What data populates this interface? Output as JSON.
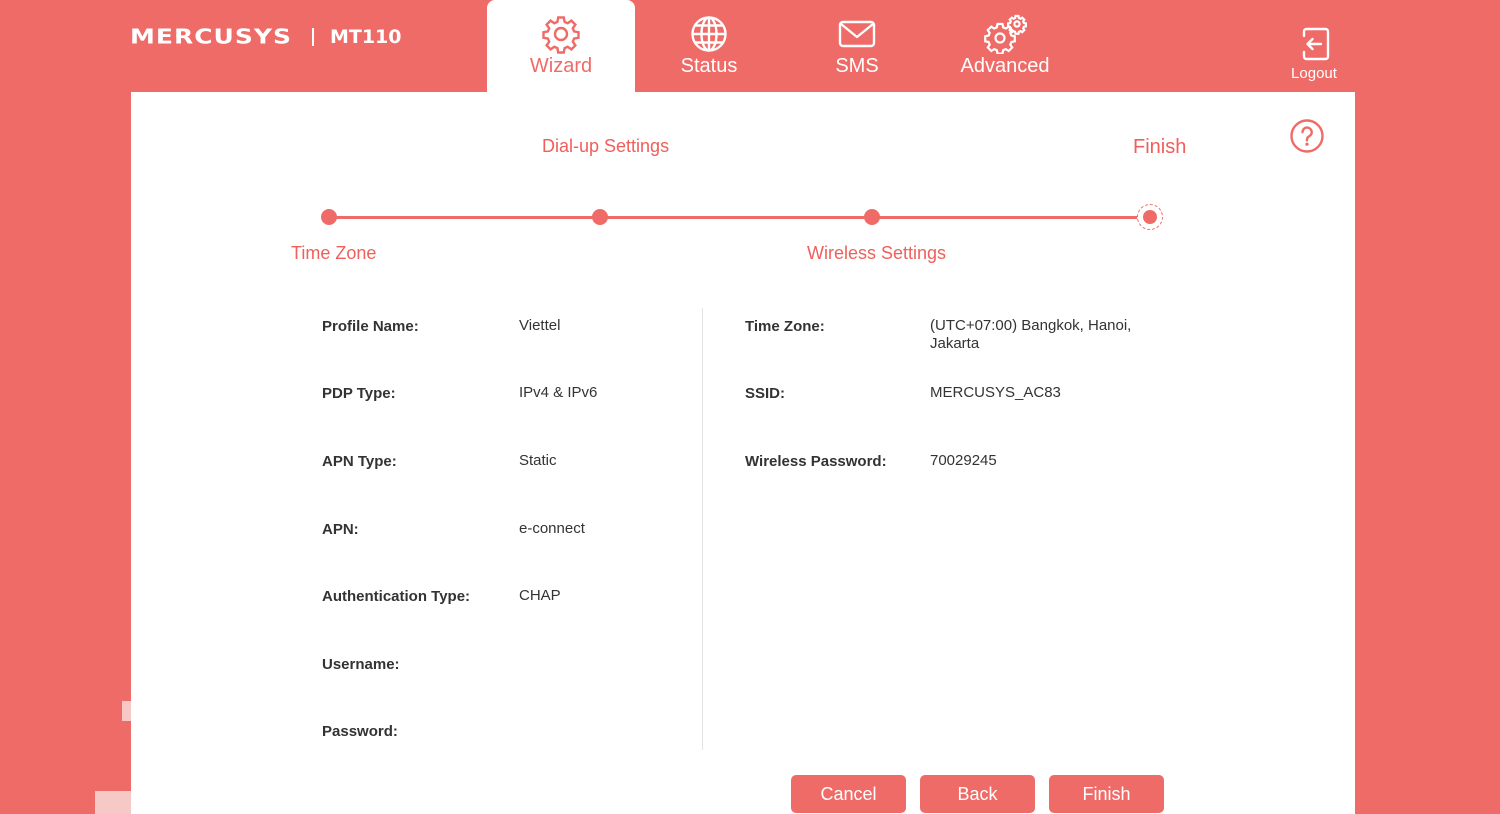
{
  "header": {
    "brand": "MERCUSYS",
    "model": "MT110",
    "tabs": [
      {
        "label": "Wizard",
        "icon": "gear-icon",
        "active": true
      },
      {
        "label": "Status",
        "icon": "globe-icon",
        "active": false
      },
      {
        "label": "SMS",
        "icon": "envelope-icon",
        "active": false
      },
      {
        "label": "Advanced",
        "icon": "gears-icon",
        "active": false
      }
    ],
    "logout_label": "Logout"
  },
  "steps": {
    "labels": [
      "Time Zone",
      "Dial-up Settings",
      "Wireless Settings",
      "Finish"
    ],
    "current": "Finish"
  },
  "summary": {
    "left": [
      {
        "label": "Profile Name:",
        "value": "Viettel"
      },
      {
        "label": "PDP Type:",
        "value": "IPv4 & IPv6"
      },
      {
        "label": "APN Type:",
        "value": "Static"
      },
      {
        "label": "APN:",
        "value": "e-connect"
      },
      {
        "label": "Authentication Type:",
        "value": "CHAP"
      },
      {
        "label": "Username:",
        "value": ""
      },
      {
        "label": "Password:",
        "value": ""
      }
    ],
    "right": [
      {
        "label": "Time Zone:",
        "value": "(UTC+07:00) Bangkok, Hanoi, Jakarta"
      },
      {
        "label": "SSID:",
        "value": "MERCUSYS_AC83"
      },
      {
        "label": "Wireless Password:",
        "value": "70029245"
      }
    ]
  },
  "buttons": {
    "cancel": "Cancel",
    "back": "Back",
    "finish": "Finish"
  },
  "colors": {
    "accent": "#ef6b67",
    "panel": "#ffffff",
    "text": "#333333"
  }
}
